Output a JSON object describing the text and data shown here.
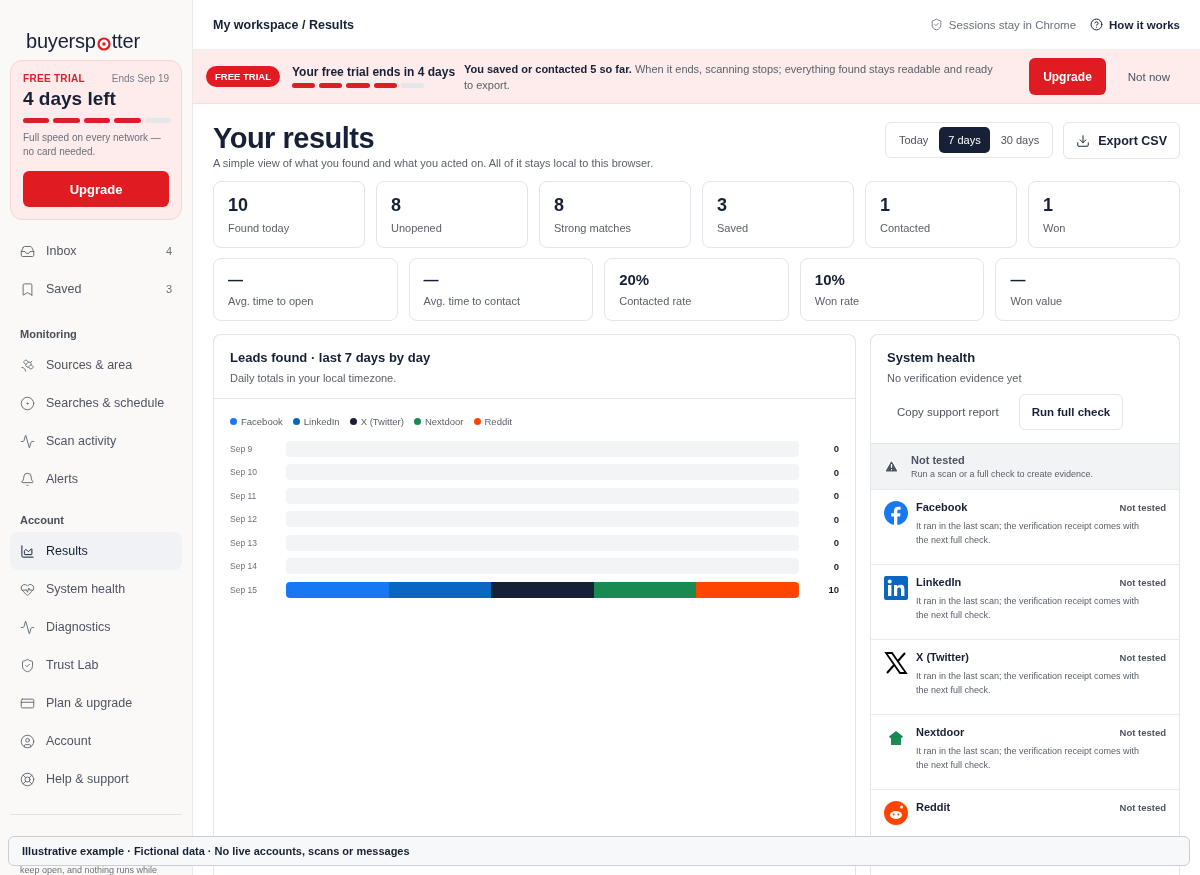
{
  "logo": {
    "text_start": "buyersp",
    "text_end": "tter"
  },
  "trial_card": {
    "label": "FREE TRIAL",
    "ends": "Ends Sep 19",
    "title": "4 days left",
    "level": 0.8,
    "note": "Full speed on every network — no card needed.",
    "button": "Upgrade"
  },
  "nav_top": [
    {
      "label": "Inbox",
      "count": "4",
      "selected": false
    },
    {
      "label": "Saved",
      "count": "3",
      "selected": false
    }
  ],
  "nav_sections": [
    {
      "title": "Monitoring",
      "items": [
        {
          "label": "Sources & area",
          "selected": false
        },
        {
          "label": "Searches & schedule",
          "selected": false
        },
        {
          "label": "Scan activity",
          "selected": false
        },
        {
          "label": "Alerts",
          "selected": false
        }
      ]
    },
    {
      "title": "Account",
      "items": [
        {
          "label": "Results",
          "selected": true
        },
        {
          "label": "System health",
          "selected": false
        },
        {
          "label": "Diagnostics",
          "selected": false
        },
        {
          "label": "Trust Lab",
          "selected": false
        },
        {
          "label": "Plan & upgrade",
          "selected": false
        },
        {
          "label": "Account",
          "selected": false
        },
        {
          "label": "Help & support",
          "selected": false
        }
      ]
    }
  ],
  "sidebar_note": "keep open, and nothing runs while",
  "breadcrumb": {
    "parent": "My workspace",
    "separator": "/",
    "current": "Results"
  },
  "header_links": {
    "sessions": "Sessions stay in Chrome",
    "help": "How it works"
  },
  "banner": {
    "badge": "FREE TRIAL",
    "title": "Your free trial ends in 4 days",
    "level": 0.8,
    "message": "**You saved or contacted 5 so far.** When it ends, scanning stops; everything found stays readable and ready to export.",
    "upgrade": "Upgrade",
    "dismiss": "Not now"
  },
  "page": {
    "title": "Your results",
    "subtitle": "A simple view of what you found and what you acted on. All of it stays local to this browser."
  },
  "ranges": [
    {
      "label": "Today",
      "selected": false
    },
    {
      "label": "7 days",
      "selected": true
    },
    {
      "label": "30 days",
      "selected": false
    }
  ],
  "export_button": "Export CSV",
  "stats": [
    {
      "value": "10",
      "label": "Found today"
    },
    {
      "value": "8",
      "label": "Unopened"
    },
    {
      "value": "8",
      "label": "Strong matches"
    },
    {
      "value": "3",
      "label": "Saved"
    },
    {
      "value": "1",
      "label": "Contacted"
    },
    {
      "value": "1",
      "label": "Won"
    }
  ],
  "rates": [
    {
      "value": "—",
      "label": "Avg. time to open"
    },
    {
      "value": "—",
      "label": "Avg. time to contact"
    },
    {
      "value": "20%",
      "label": "Contacted rate"
    },
    {
      "value": "10%",
      "label": "Won rate"
    },
    {
      "value": "—",
      "label": "Won value"
    }
  ],
  "leads_panel": {
    "title": "Leads found · last 7 days by day",
    "subtitle": "Daily totals in your local timezone.",
    "legend": [
      {
        "name": "Facebook",
        "color": "#1877f2"
      },
      {
        "name": "LinkedIn",
        "color": "#0a66c2"
      },
      {
        "name": "X (Twitter)",
        "color": "#172036"
      },
      {
        "name": "Nextdoor",
        "color": "#188a52"
      },
      {
        "name": "Reddit",
        "color": "#ff4500"
      }
    ],
    "days": [
      {
        "label": "Sep 9",
        "total": "0"
      },
      {
        "label": "Sep 10",
        "total": "0"
      },
      {
        "label": "Sep 11",
        "total": "0"
      },
      {
        "label": "Sep 12",
        "total": "0"
      },
      {
        "label": "Sep 13",
        "total": "0"
      },
      {
        "label": "Sep 14",
        "total": "0"
      },
      {
        "label": "Sep 15",
        "total": "10",
        "segments": [
          {
            "color": "#1877f2"
          },
          {
            "color": "#0a66c2"
          },
          {
            "color": "#172036"
          },
          {
            "color": "#188a52"
          },
          {
            "color": "#ff4500"
          }
        ]
      }
    ]
  },
  "health_panel": {
    "title": "System health",
    "subtitle": "No verification evidence yet",
    "copy_button": "Copy support report",
    "run_button": "Run full check",
    "notice": {
      "title": "Not tested",
      "text": "Run a scan or a full check to create evidence."
    },
    "networks": [
      {
        "kind": "facebook",
        "name": "Facebook",
        "status": "Not tested",
        "text": "It ran in the last scan; the verification receipt comes with the next full check."
      },
      {
        "kind": "linkedin",
        "name": "LinkedIn",
        "status": "Not tested",
        "text": "It ran in the last scan; the verification receipt comes with the next full check."
      },
      {
        "kind": "x",
        "name": "X (Twitter)",
        "status": "Not tested",
        "text": "It ran in the last scan; the verification receipt comes with the next full check."
      },
      {
        "kind": "nextdoor",
        "name": "Nextdoor",
        "status": "Not tested",
        "text": "It ran in the last scan; the verification receipt comes with the next full check."
      },
      {
        "kind": "reddit",
        "name": "Reddit",
        "status": "Not tested"
      }
    ]
  },
  "toast": "Illustrative example · Fictional data · No live accounts, scans or messages"
}
